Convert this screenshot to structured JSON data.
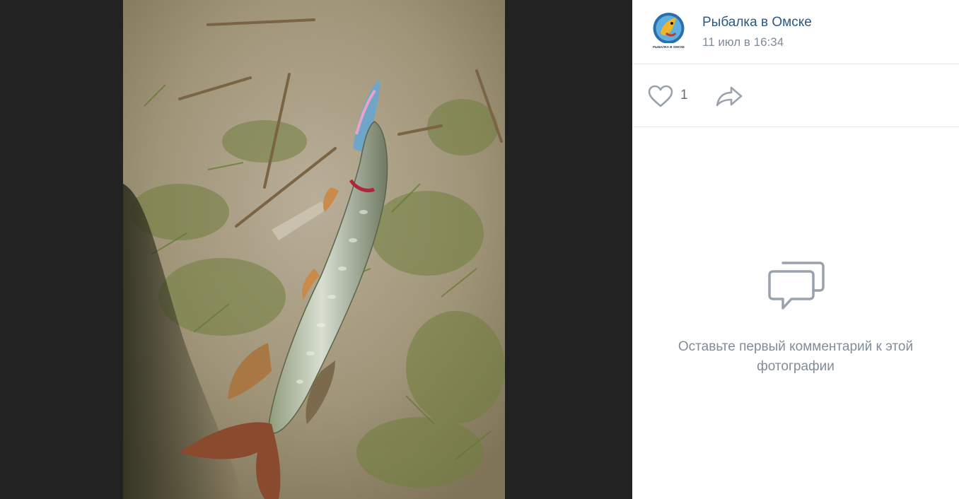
{
  "post": {
    "group_name": "Рыбалка в Омске",
    "date": "11 июл в 16:34",
    "avatar_icon": "fish-logo-icon",
    "avatar_caption": "РЫБАЛКА В ОМСКЕ"
  },
  "actions": {
    "like_icon": "heart-icon",
    "like_count": "1",
    "share_icon": "share-arrow-icon"
  },
  "comments": {
    "empty_icon": "comments-bubble-icon",
    "empty_text": "Оставьте первый комментарий к этой фотографии"
  },
  "colors": {
    "viewer_background": "#222222",
    "link": "#2a5885",
    "secondary_text": "#818c99",
    "icon_gray": "#99a2ad"
  }
}
